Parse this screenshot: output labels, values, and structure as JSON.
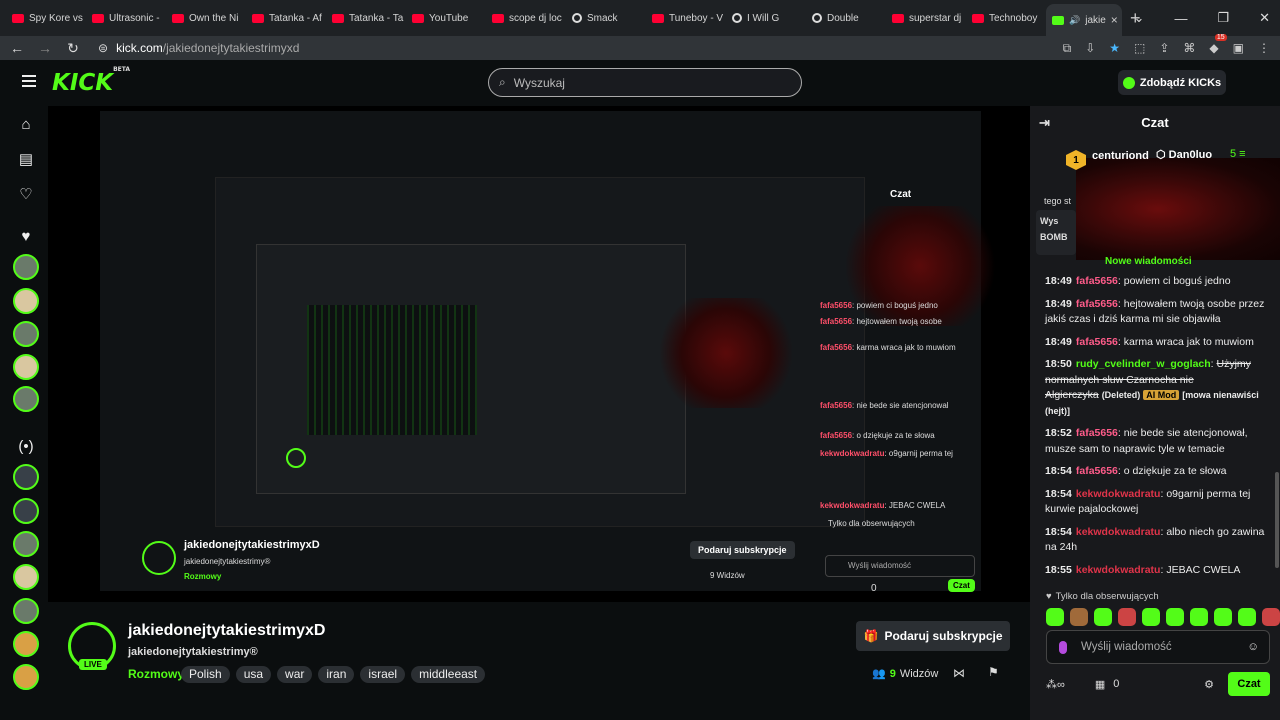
{
  "browser": {
    "tabs": [
      {
        "label": "Spy Kore vs",
        "icon": "youtube-icon"
      },
      {
        "label": "Ultrasonic -",
        "icon": "youtube-icon"
      },
      {
        "label": "Own the Ni",
        "icon": "youtube-icon"
      },
      {
        "label": "Tatanka - Af",
        "icon": "youtube-icon"
      },
      {
        "label": "Tatanka - Ta",
        "icon": "youtube-icon"
      },
      {
        "label": "YouTube",
        "icon": "youtube-icon"
      },
      {
        "label": "scope dj loc",
        "icon": "youtube-icon"
      },
      {
        "label": "Smack",
        "icon": "music-icon"
      },
      {
        "label": "Tuneboy - V",
        "icon": "youtube-icon"
      },
      {
        "label": "I Will G",
        "icon": "music-icon"
      },
      {
        "label": "Double",
        "icon": "music-icon"
      },
      {
        "label": "superstar dj",
        "icon": "youtube-icon"
      },
      {
        "label": "Technoboy",
        "icon": "youtube-icon"
      },
      {
        "label": "jakie",
        "icon": "kick-icon",
        "active": true
      }
    ],
    "url_host": "kick.com",
    "url_path": "/jakiedonejtytakiestrimyxd",
    "extension_badge": "15"
  },
  "header": {
    "logo": "KICK",
    "logo_sup": "BETA",
    "search_placeholder": "Wyszukaj",
    "kicks_button": "Zdobądź KICKs"
  },
  "stream": {
    "channel_name": "jakiedonejtytakiestrimyxD",
    "title": "jakiedonejtytakiestrimy®",
    "category": "Rozmowy",
    "tags": [
      "Polish",
      "usa",
      "war",
      "iran",
      "israel",
      "middleeast"
    ],
    "live_label": "LIVE",
    "gift_button": "Podaruj subskrypcje",
    "viewers_count": "9",
    "viewers_label": "Widzów"
  },
  "nested_stream": {
    "channel_name": "jakiedonejtytakiestrimyxD",
    "title": "jakiedonejtytakiestrimy®",
    "category": "Rozmowy",
    "gift_button": "Podaruj subskrypcje",
    "viewers": "9 Widzów",
    "chat_header": "Czat",
    "chat_input": "Wyślij wiadomość",
    "chat_button": "Czat",
    "followers_only": "Tylko dla obserwujących",
    "points": "0"
  },
  "chat": {
    "header": "Czat",
    "top_gifter_1": "centuriond",
    "top_gifter_1_rank": "1",
    "top_gifter_2": "Dan0luo",
    "top_gifter_2_count": "5",
    "pinned_prefix": "tego st",
    "pinned_label": "Wys",
    "pinned_word": "BOMB",
    "new_messages": "Nowe wiadomości",
    "messages": [
      {
        "time": "18:49",
        "user": "fafa5656",
        "user_color": "#ff5c8a",
        "text": "powiem ci boguś jedno"
      },
      {
        "time": "18:49",
        "user": "fafa5656",
        "user_color": "#ff5c8a",
        "text": "hejtowałem twoją osobe przez jakiś czas i dziś karma mi sie objawiła"
      },
      {
        "time": "18:49",
        "user": "fafa5656",
        "user_color": "#ff5c8a",
        "text": "karma wraca jak to muwiom"
      },
      {
        "time": "18:50",
        "user": "rudy_cvelinder_w_goglach",
        "user_color": "#53fc18",
        "text": "Użyjmy normalnych słuw Czarnocha nie Algierczyka",
        "deleted_label": "(Deleted)",
        "badge": "AI Mod",
        "note": "[mowa nienawiści (hejt)]",
        "deleted": true
      },
      {
        "time": "18:52",
        "user": "fafa5656",
        "user_color": "#ff5c8a",
        "text": "nie bede sie atencjonował, musze sam to naprawic tyle w temacie"
      },
      {
        "time": "18:54",
        "user": "fafa5656",
        "user_color": "#ff5c8a",
        "text": "o dziękuje za te słowa"
      },
      {
        "time": "18:54",
        "user": "kekwdokwadratu",
        "user_color": "#e0344a",
        "text": "o9garnij perma tej kurwie pajalockowej"
      },
      {
        "time": "18:54",
        "user": "kekwdokwadratu",
        "user_color": "#e0344a",
        "text": "albo niech go zawina na 24h"
      },
      {
        "time": "18:55",
        "user": "kekwdokwadratu",
        "user_color": "#e0344a",
        "text": "JEBAC CWELA"
      }
    ],
    "followers_only": "Tylko dla obserwujących",
    "input_placeholder": "Wyślij wiadomość",
    "points": "0",
    "send_button": "Czat"
  }
}
